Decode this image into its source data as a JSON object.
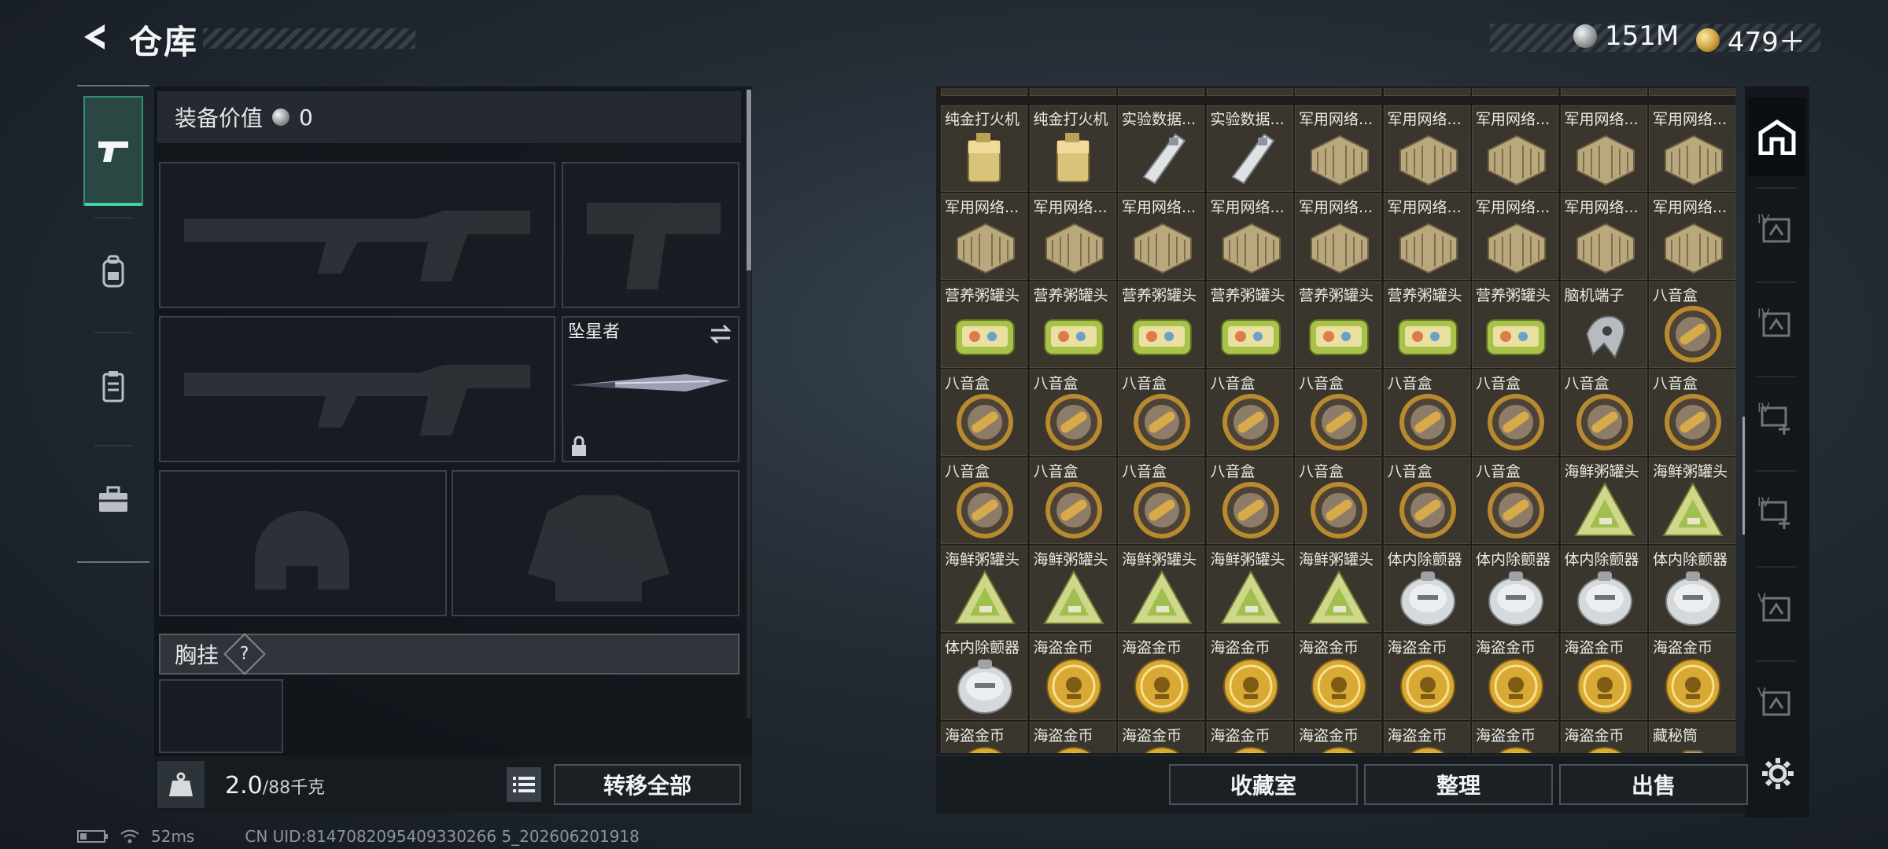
{
  "header": {
    "title": "仓库",
    "currency_silver": "151M",
    "currency_gold": "479＋"
  },
  "equipment": {
    "value_label": "装备价值",
    "value": "0",
    "melee_name": "坠星者",
    "chest_label": "胸挂",
    "chest_help": "?"
  },
  "footer_left": {
    "weight_current": "2.0",
    "weight_max": "/88千克",
    "transfer_all": "转移全部"
  },
  "footer_right": {
    "collection": "收藏室",
    "organize": "整理",
    "sell": "出售"
  },
  "status": {
    "ping": "52ms",
    "uid": "CN UID:8147082095409330266 5_202606201918"
  },
  "stash": {
    "rows": [
      [
        "纯金打火机",
        "纯金打火机",
        "实验数据...",
        "实验数据...",
        "军用网络...",
        "军用网络...",
        "军用网络...",
        "军用网络...",
        "军用网络..."
      ],
      [
        "军用网络...",
        "军用网络...",
        "军用网络...",
        "军用网络...",
        "军用网络...",
        "军用网络...",
        "军用网络...",
        "军用网络...",
        "军用网络..."
      ],
      [
        "营养粥罐头",
        "营养粥罐头",
        "营养粥罐头",
        "营养粥罐头",
        "营养粥罐头",
        "营养粥罐头",
        "营养粥罐头",
        "脑机端子",
        "八音盒"
      ],
      [
        "八音盒",
        "八音盒",
        "八音盒",
        "八音盒",
        "八音盒",
        "八音盒",
        "八音盒",
        "八音盒",
        "八音盒"
      ],
      [
        "八音盒",
        "八音盒",
        "八音盒",
        "八音盒",
        "八音盒",
        "八音盒",
        "八音盒",
        "海鲜粥罐头",
        "海鲜粥罐头"
      ],
      [
        "海鲜粥罐头",
        "海鲜粥罐头",
        "海鲜粥罐头",
        "海鲜粥罐头",
        "海鲜粥罐头",
        "体内除颤器",
        "体内除颤器",
        "体内除颤器",
        "体内除颤器"
      ],
      [
        "体内除颤器",
        "海盗金币",
        "海盗金币",
        "海盗金币",
        "海盗金币",
        "海盗金币",
        "海盗金币",
        "海盗金币",
        "海盗金币"
      ],
      [
        "海盗金币",
        "海盗金币",
        "海盗金币",
        "海盗金币",
        "海盗金币",
        "海盗金币",
        "海盗金币",
        "海盗金币",
        "藏秘筒"
      ]
    ],
    "tab_labels": [
      "IV",
      "IV",
      "IV",
      "IV",
      "V",
      "V"
    ]
  },
  "colors": {
    "accent": "#3fd3a5",
    "stash_cell": "#3a352d"
  }
}
